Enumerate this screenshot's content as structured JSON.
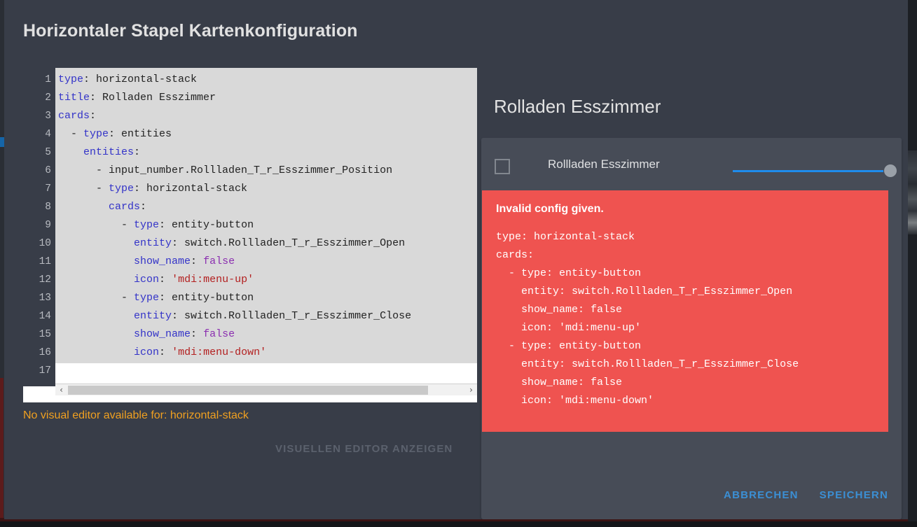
{
  "dialog": {
    "title": "Horizontaler Stapel Kartenkonfiguration",
    "no_visual_editor_text": "No visual editor available for: horizontal-stack",
    "show_visual_editor_label": "VISUELLEN EDITOR ANZEIGEN",
    "cancel_label": "ABBRECHEN",
    "save_label": "SPEICHERN"
  },
  "editor": {
    "line_numbers": [
      "1",
      "2",
      "3",
      "4",
      "5",
      "6",
      "7",
      "8",
      "9",
      "10",
      "11",
      "12",
      "13",
      "14",
      "15",
      "16",
      "17"
    ],
    "lines": [
      {
        "n": 1,
        "segments": [
          {
            "t": "type",
            "c": "key"
          },
          {
            "t": ": horizontal-stack",
            "c": "plain"
          }
        ]
      },
      {
        "n": 2,
        "segments": [
          {
            "t": "title",
            "c": "key"
          },
          {
            "t": ": Rolladen Esszimmer",
            "c": "plain"
          }
        ]
      },
      {
        "n": 3,
        "segments": [
          {
            "t": "cards",
            "c": "key"
          },
          {
            "t": ":",
            "c": "plain"
          }
        ]
      },
      {
        "n": 4,
        "segments": [
          {
            "t": "  - ",
            "c": "dash"
          },
          {
            "t": "type",
            "c": "key"
          },
          {
            "t": ": entities",
            "c": "plain"
          }
        ]
      },
      {
        "n": 5,
        "segments": [
          {
            "t": "    ",
            "c": "plain"
          },
          {
            "t": "entities",
            "c": "key"
          },
          {
            "t": ":",
            "c": "plain"
          }
        ]
      },
      {
        "n": 6,
        "segments": [
          {
            "t": "      - input_number.Rollladen_T_r_Esszimmer_Position",
            "c": "plain"
          }
        ]
      },
      {
        "n": 7,
        "segments": [
          {
            "t": "      - ",
            "c": "dash"
          },
          {
            "t": "type",
            "c": "key"
          },
          {
            "t": ": horizontal-stack",
            "c": "plain"
          }
        ]
      },
      {
        "n": 8,
        "segments": [
          {
            "t": "        ",
            "c": "plain"
          },
          {
            "t": "cards",
            "c": "key"
          },
          {
            "t": ":",
            "c": "plain"
          }
        ]
      },
      {
        "n": 9,
        "segments": [
          {
            "t": "          - ",
            "c": "dash"
          },
          {
            "t": "type",
            "c": "key"
          },
          {
            "t": ": entity-button",
            "c": "plain"
          }
        ]
      },
      {
        "n": 10,
        "segments": [
          {
            "t": "            ",
            "c": "plain"
          },
          {
            "t": "entity",
            "c": "key"
          },
          {
            "t": ": switch.Rollladen_T_r_Esszimmer_Open",
            "c": "plain"
          }
        ]
      },
      {
        "n": 11,
        "segments": [
          {
            "t": "            ",
            "c": "plain"
          },
          {
            "t": "show_name",
            "c": "key"
          },
          {
            "t": ": ",
            "c": "plain"
          },
          {
            "t": "false",
            "c": "bool"
          }
        ]
      },
      {
        "n": 12,
        "segments": [
          {
            "t": "            ",
            "c": "plain"
          },
          {
            "t": "icon",
            "c": "key"
          },
          {
            "t": ": ",
            "c": "plain"
          },
          {
            "t": "'mdi:menu-up'",
            "c": "str"
          }
        ]
      },
      {
        "n": 13,
        "segments": [
          {
            "t": "          - ",
            "c": "dash"
          },
          {
            "t": "type",
            "c": "key"
          },
          {
            "t": ": entity-button",
            "c": "plain"
          }
        ]
      },
      {
        "n": 14,
        "segments": [
          {
            "t": "            ",
            "c": "plain"
          },
          {
            "t": "entity",
            "c": "key"
          },
          {
            "t": ": switch.Rollladen_T_r_Esszimmer_Close",
            "c": "plain"
          }
        ]
      },
      {
        "n": 15,
        "segments": [
          {
            "t": "            ",
            "c": "plain"
          },
          {
            "t": "show_name",
            "c": "key"
          },
          {
            "t": ": ",
            "c": "plain"
          },
          {
            "t": "false",
            "c": "bool"
          }
        ]
      },
      {
        "n": 16,
        "segments": [
          {
            "t": "            ",
            "c": "plain"
          },
          {
            "t": "icon",
            "c": "key"
          },
          {
            "t": ": ",
            "c": "plain"
          },
          {
            "t": "'mdi:menu-down'",
            "c": "str"
          }
        ]
      },
      {
        "n": 17,
        "segments": []
      }
    ],
    "scrollbar": {
      "left_arrow": "‹",
      "right_arrow": "›"
    }
  },
  "preview": {
    "card_title": "Rolladen Esszimmer",
    "entity_row": {
      "icon_name": "unknown-entity-square-icon",
      "label": "Rollladen Esszimmer",
      "slider_value": 100
    },
    "error": {
      "title": "Invalid config given.",
      "code": "type: horizontal-stack\ncards:\n  - type: entity-button\n    entity: switch.Rollladen_T_r_Esszimmer_Open\n    show_name: false\n    icon: 'mdi:menu-up'\n  - type: entity-button\n    entity: switch.Rollladen_T_r_Esszimmer_Close\n    show_name: false\n    icon: 'mdi:menu-down'"
    }
  },
  "colors": {
    "dialog_bg": "#383d48",
    "card_bg": "#474c57",
    "error_bg": "#ef5350",
    "accent_link": "#3b8fd4",
    "warning": "#f0a020",
    "slider_track": "#1f8cec"
  }
}
